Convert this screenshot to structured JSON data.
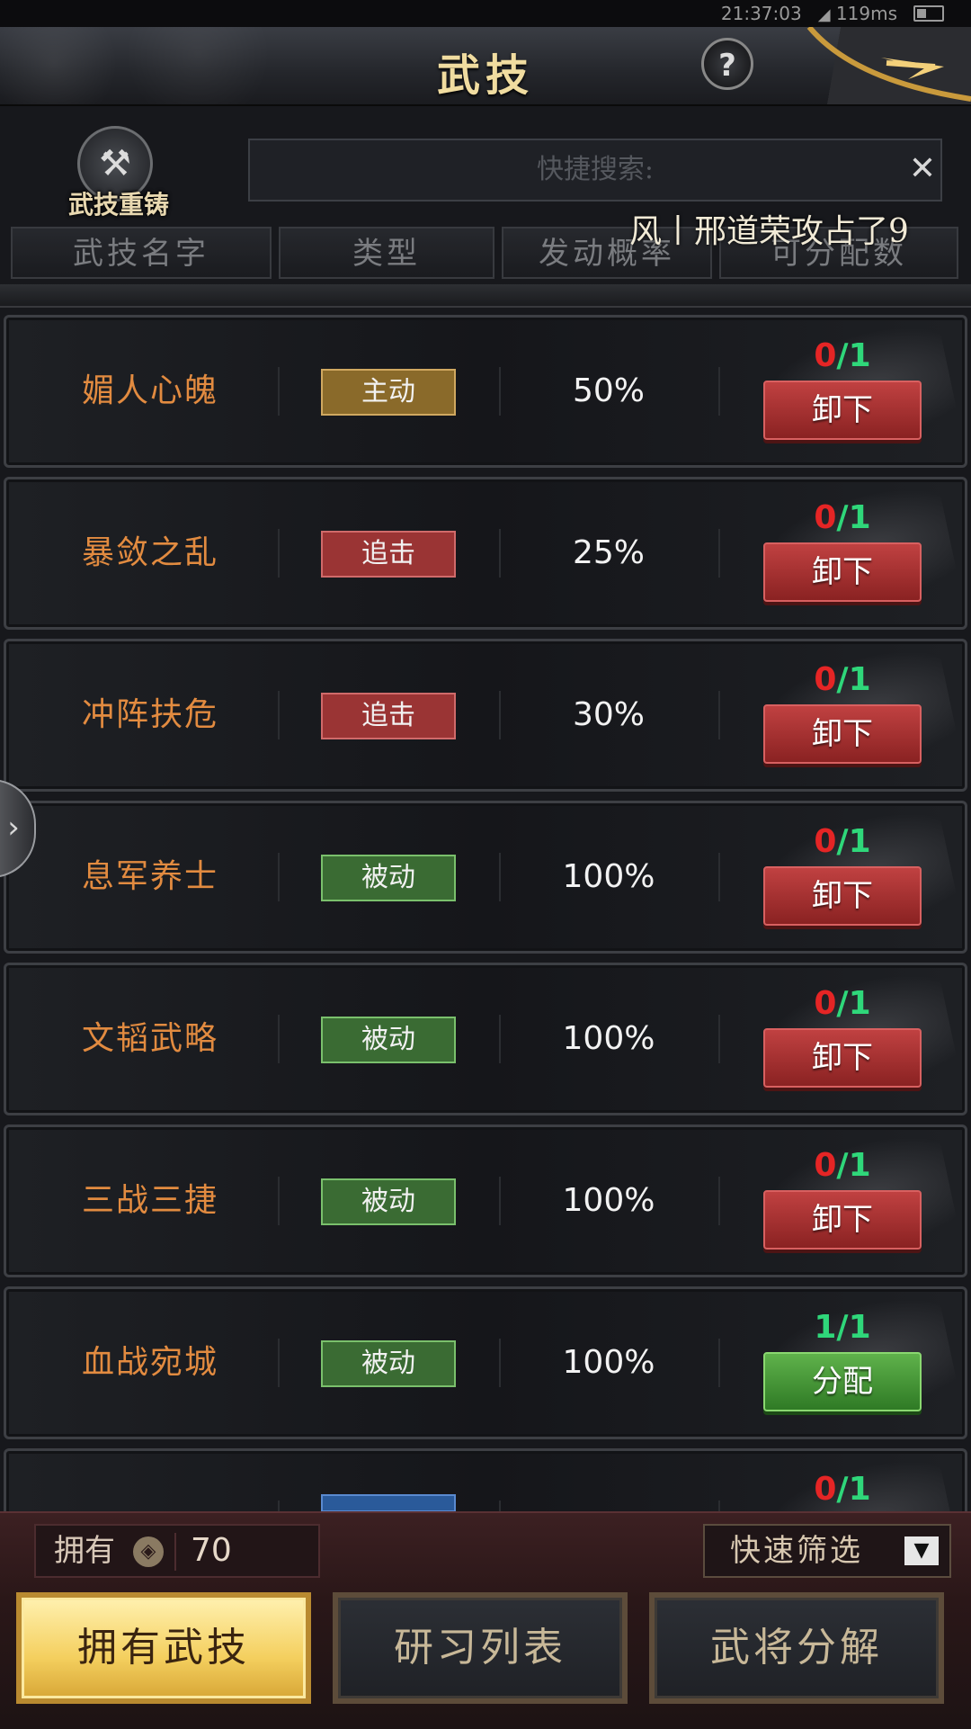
{
  "status": {
    "time": "21:37:03",
    "ping": "119ms"
  },
  "header": {
    "title": "武技",
    "help_label": "?"
  },
  "reforge": {
    "label": "武技重铸"
  },
  "search": {
    "placeholder": "快捷搜索:",
    "clear_label": "✕"
  },
  "ticker": {
    "text": "风丨邢道荣攻占了9"
  },
  "columns": [
    "武技名字",
    "类型",
    "发动概率",
    "可分配数"
  ],
  "skills": [
    {
      "name": "媚人心魄",
      "type": "主动",
      "type_kind": "active",
      "prob": "50%",
      "used": "0",
      "total": "1",
      "action": "卸下",
      "action_kind": "remove"
    },
    {
      "name": "暴敛之乱",
      "type": "追击",
      "type_kind": "chase",
      "prob": "25%",
      "used": "0",
      "total": "1",
      "action": "卸下",
      "action_kind": "remove"
    },
    {
      "name": "冲阵扶危",
      "type": "追击",
      "type_kind": "chase",
      "prob": "30%",
      "used": "0",
      "total": "1",
      "action": "卸下",
      "action_kind": "remove"
    },
    {
      "name": "息军养士",
      "type": "被动",
      "type_kind": "passive",
      "prob": "100%",
      "used": "0",
      "total": "1",
      "action": "卸下",
      "action_kind": "remove"
    },
    {
      "name": "文韬武略",
      "type": "被动",
      "type_kind": "passive",
      "prob": "100%",
      "used": "0",
      "total": "1",
      "action": "卸下",
      "action_kind": "remove"
    },
    {
      "name": "三战三捷",
      "type": "被动",
      "type_kind": "passive",
      "prob": "100%",
      "used": "0",
      "total": "1",
      "action": "卸下",
      "action_kind": "remove"
    },
    {
      "name": "血战宛城",
      "type": "被动",
      "type_kind": "passive",
      "prob": "100%",
      "used": "1",
      "total": "1",
      "action": "分配",
      "action_kind": "assign"
    },
    {
      "name": "",
      "type": "",
      "type_kind": "blue",
      "prob": "",
      "used": "0",
      "total": "1",
      "action": "",
      "action_kind": "none"
    }
  ],
  "footer": {
    "owned_label": "拥有",
    "owned_value": "70",
    "filter_label": "快速筛选",
    "tabs": [
      "拥有武技",
      "研习列表",
      "武将分解"
    ]
  },
  "colors": {
    "accent_gold": "#f4cf5e",
    "name_orange": "#e28b40",
    "red": "#e52525",
    "green": "#2fd77a"
  }
}
